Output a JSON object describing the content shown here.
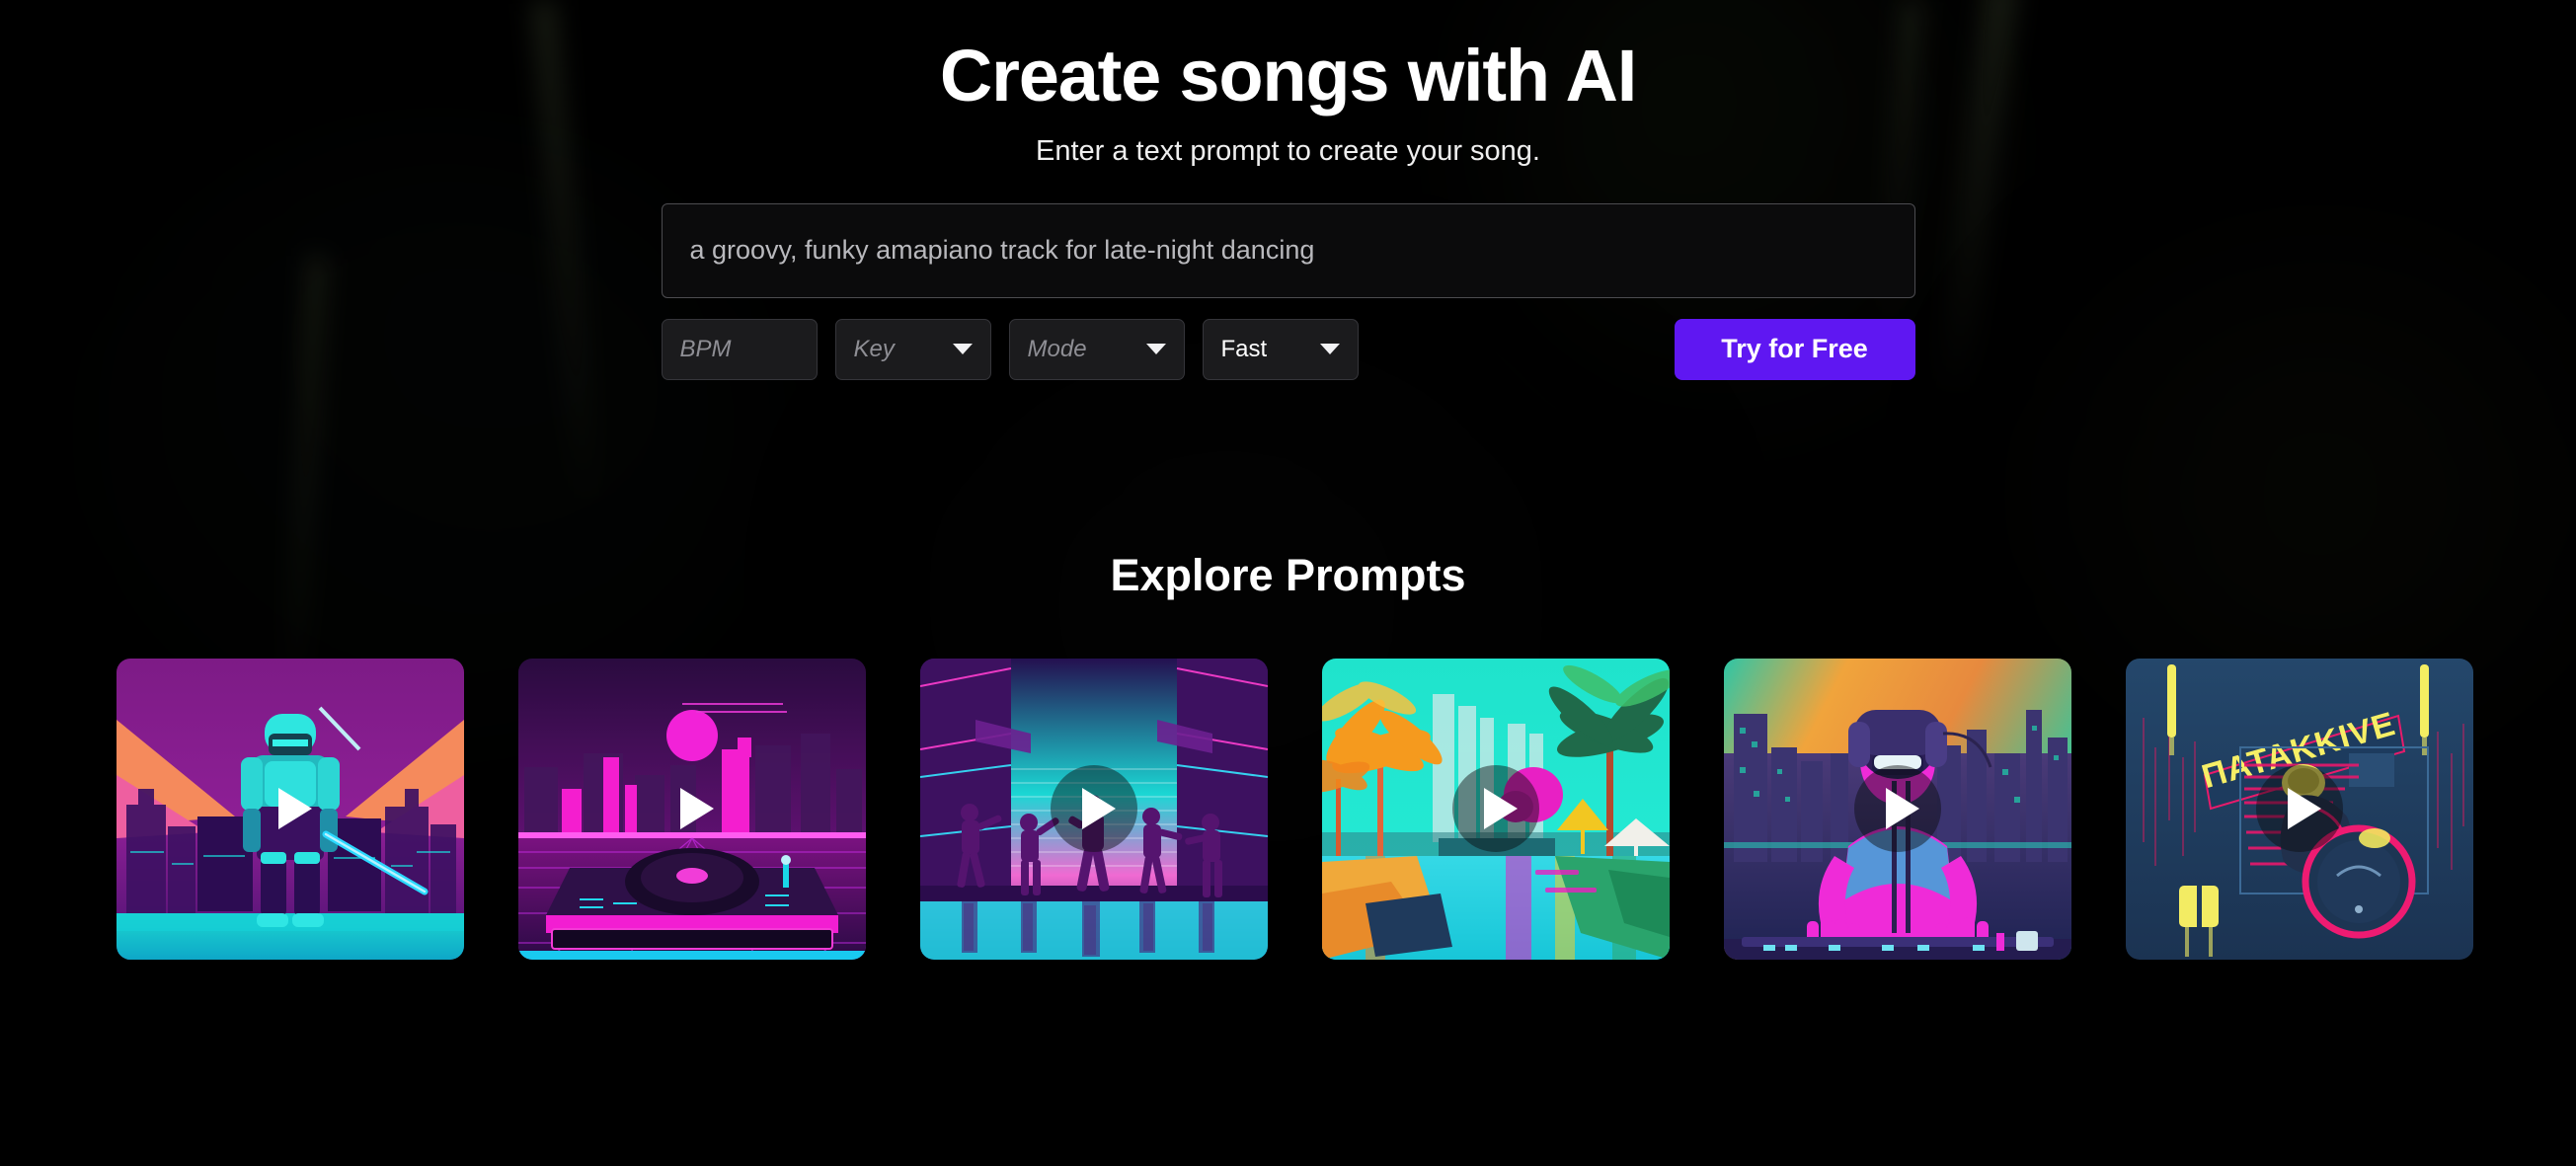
{
  "hero": {
    "title": "Create songs with AI",
    "subtitle": "Enter a text prompt to create your song."
  },
  "composer": {
    "prompt_placeholder": "a groovy, funky amapiano track for late-night dancing",
    "prompt_value": "",
    "controls": [
      {
        "name": "bpm",
        "label": "BPM",
        "filled": false,
        "has_caret": false
      },
      {
        "name": "key",
        "label": "Key",
        "filled": false,
        "has_caret": true
      },
      {
        "name": "mode",
        "label": "Mode",
        "filled": false,
        "has_caret": true
      },
      {
        "name": "speed",
        "label": "Fast",
        "filled": true,
        "has_caret": true
      }
    ],
    "cta_label": "Try for Free"
  },
  "explore": {
    "title": "Explore Prompts",
    "play_icon": "play-icon",
    "cards": [
      {
        "name": "card-cyber-samurai",
        "art": "cyber-samurai",
        "play_disc": false
      },
      {
        "name": "card-synth-turntable",
        "art": "synth-turntable",
        "play_disc": false
      },
      {
        "name": "card-neon-dancers",
        "art": "neon-dancers",
        "play_disc": true
      },
      {
        "name": "card-tropical-canal",
        "art": "tropical-canal",
        "play_disc": true
      },
      {
        "name": "card-dj-skyline",
        "art": "dj-skyline",
        "play_disc": true
      },
      {
        "name": "card-neon-drums",
        "art": "neon-drums",
        "play_disc": true,
        "sign_text": "ΠΑΤΑΚΚΙVE"
      }
    ]
  },
  "colors": {
    "background": "#000000",
    "accent": "#5f17f2",
    "text_primary": "#ffffff",
    "text_muted": "#b9b9bd",
    "control_bg": "#1b1b1d",
    "control_border": "#35353a"
  }
}
